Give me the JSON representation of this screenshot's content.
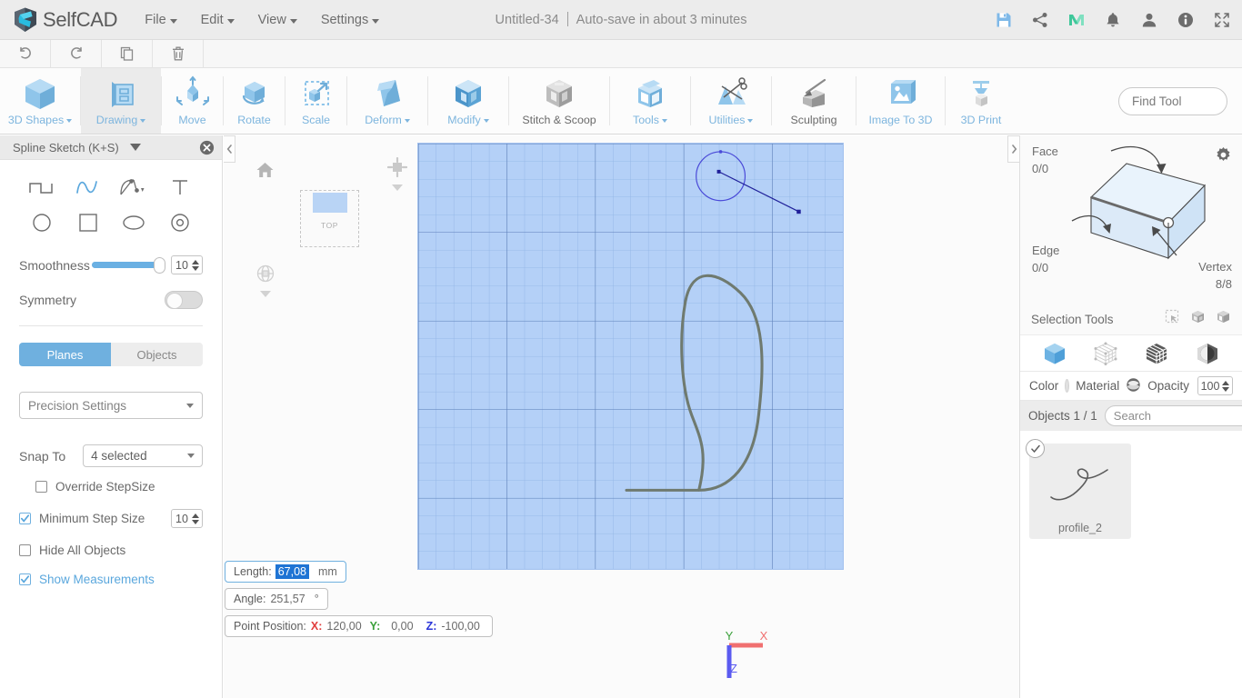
{
  "app": {
    "brand": "SelfCAD",
    "brand_logo_icon": "selfcad-logo-icon"
  },
  "menubar": {
    "items": [
      {
        "label": "File"
      },
      {
        "label": "Edit"
      },
      {
        "label": "View"
      },
      {
        "label": "Settings"
      }
    ],
    "document_title": "Untitled-34",
    "autosave_text": "Auto-save in about 3 minutes",
    "icons": [
      {
        "name": "save-icon"
      },
      {
        "name": "share-icon"
      },
      {
        "name": "mymini-m-icon"
      },
      {
        "name": "notifications-bell-icon"
      },
      {
        "name": "user-account-icon"
      },
      {
        "name": "info-icon"
      },
      {
        "name": "fullscreen-icon"
      }
    ]
  },
  "undobar": {
    "buttons": [
      {
        "name": "undo-button",
        "icon": "undo-arrow-icon"
      },
      {
        "name": "redo-button",
        "icon": "redo-arrow-icon"
      },
      {
        "name": "copy-button",
        "icon": "copy-icon"
      },
      {
        "name": "delete-button",
        "icon": "trash-icon"
      }
    ]
  },
  "ribbon": {
    "tools": [
      {
        "label": "3D Shapes",
        "icon": "cube-icon",
        "dropdown": true,
        "active": false
      },
      {
        "label": "Drawing",
        "icon": "drawing-sketch-icon",
        "dropdown": true,
        "active": true
      },
      {
        "label": "Move",
        "icon": "move-arrows-icon",
        "dropdown": false,
        "active": false
      },
      {
        "label": "Rotate",
        "icon": "rotate-icon",
        "dropdown": false,
        "active": false
      },
      {
        "label": "Scale",
        "icon": "scale-icon",
        "dropdown": false,
        "active": false
      },
      {
        "label": "Deform",
        "icon": "deform-icon",
        "dropdown": true,
        "active": false
      },
      {
        "label": "Modify",
        "icon": "modify-icon",
        "dropdown": true,
        "active": false
      },
      {
        "label": "Stitch & Scoop",
        "icon": "stitch-scoop-icon",
        "dropdown": false,
        "active": false
      },
      {
        "label": "Tools",
        "icon": "tools-icon",
        "dropdown": true,
        "active": false
      },
      {
        "label": "Utilities",
        "icon": "utilities-scissors-icon",
        "dropdown": true,
        "active": false
      },
      {
        "label": "Sculpting",
        "icon": "sculpting-icon",
        "dropdown": false,
        "active": false
      },
      {
        "label": "Image To 3D",
        "icon": "image-to-3d-icon",
        "dropdown": false,
        "active": false
      },
      {
        "label": "3D Print",
        "icon": "3d-print-icon",
        "dropdown": false,
        "active": false
      }
    ],
    "find_tool": {
      "placeholder": "Find Tool",
      "value": "",
      "icon": "search-icon"
    }
  },
  "left_panel": {
    "title": "Spline Sketch (K+S)",
    "collapse_icon": "chevron-down-icon",
    "close_icon": "close-circle-icon",
    "shape_tools": [
      {
        "name": "polyline-tool",
        "icon": "polyline-icon",
        "active": false
      },
      {
        "name": "spline-tool",
        "icon": "spline-curve-icon",
        "active": true
      },
      {
        "name": "bezier-tool",
        "icon": "bezier-handle-icon",
        "active": false,
        "dropdown": true
      },
      {
        "name": "text-tool",
        "icon": "text-t-icon",
        "active": false
      },
      {
        "name": "circle-tool",
        "icon": "circle-icon",
        "active": false
      },
      {
        "name": "square-tool",
        "icon": "square-icon",
        "active": false
      },
      {
        "name": "ellipse-tool",
        "icon": "ellipse-icon",
        "active": false
      },
      {
        "name": "ring-tool",
        "icon": "ring-icon",
        "active": false
      }
    ],
    "smoothness": {
      "label": "Smoothness",
      "value": "10",
      "percent": 92
    },
    "symmetry": {
      "label": "Symmetry",
      "on": false
    },
    "segment": {
      "planes_label": "Planes",
      "objects_label": "Objects",
      "selected": "Planes"
    },
    "precision_settings": {
      "label": "Precision Settings"
    },
    "snap_to": {
      "label": "Snap To",
      "value": "4 selected"
    },
    "checkboxes": [
      {
        "label": "Override StepSize",
        "checked": false,
        "blue": false,
        "spinner": null
      },
      {
        "label": "Minimum Step Size",
        "checked": true,
        "blue": false,
        "spinner": "10"
      },
      {
        "label": "Hide All Objects",
        "checked": false,
        "blue": false,
        "spinner": null
      },
      {
        "label": "Show Measurements",
        "checked": true,
        "blue": true,
        "spinner": null
      }
    ]
  },
  "viewport": {
    "collapse_left_icon": "chevron-left-icon",
    "collapse_right_icon": "chevron-right-icon",
    "home_icon": "home-icon",
    "view_cube_label": "TOP",
    "perspective_icon": "perspective-globe-icon",
    "zoom_widget_icon": "zoom-extents-icon",
    "axis_gizmo": {
      "x_label": "X",
      "y_label": "Y",
      "z_label": "Z",
      "x_color": "#f07070",
      "y_color": "#3aa03a",
      "z_color": "#5b5bf0"
    },
    "grid_color": "#b4d0f7",
    "curve_color": "#6f7a6f",
    "handle_color": "#3d3dbb"
  },
  "measurements": {
    "length": {
      "label": "Length:",
      "value": "67,08",
      "unit": "mm",
      "focused": true
    },
    "angle": {
      "label": "Angle:",
      "value": "251,57",
      "unit": "°"
    },
    "point_position": {
      "label": "Point Position:",
      "x_label": "X:",
      "x_value": "120,00",
      "y_label": "Y:",
      "y_value": "0,00",
      "z_label": "Z:",
      "z_value": "-100,00"
    }
  },
  "right_panel": {
    "gear_icon": "gear-icon",
    "face": {
      "label": "Face",
      "value": "0/0"
    },
    "edge": {
      "label": "Edge",
      "value": "0/0"
    },
    "vertex": {
      "label": "Vertex",
      "value": "8/8"
    },
    "selection_tools": {
      "label": "Selection Tools",
      "icons": [
        {
          "name": "rectangle-select-icon"
        },
        {
          "name": "select-through-icon"
        },
        {
          "name": "select-visible-icon"
        }
      ]
    },
    "mode_icons": [
      {
        "name": "object-mode-icon",
        "active": true
      },
      {
        "name": "vertex-mode-icon",
        "active": false
      },
      {
        "name": "face-mode-icon",
        "active": false
      },
      {
        "name": "shading-mode-icon",
        "active": false
      }
    ],
    "color_label": "Color",
    "material_label": "Material",
    "material_icon": "material-sphere-icon",
    "opacity_label": "Opacity",
    "opacity_value": "100",
    "objects_header": "Objects 1 / 1",
    "search": {
      "placeholder": "Search",
      "value": "",
      "icon": "search-icon"
    },
    "objects_gear_icon": "gear-icon",
    "objects": [
      {
        "name": "profile_2",
        "selected": true,
        "thumb_icon": "spline-thumbnail-icon"
      }
    ]
  }
}
